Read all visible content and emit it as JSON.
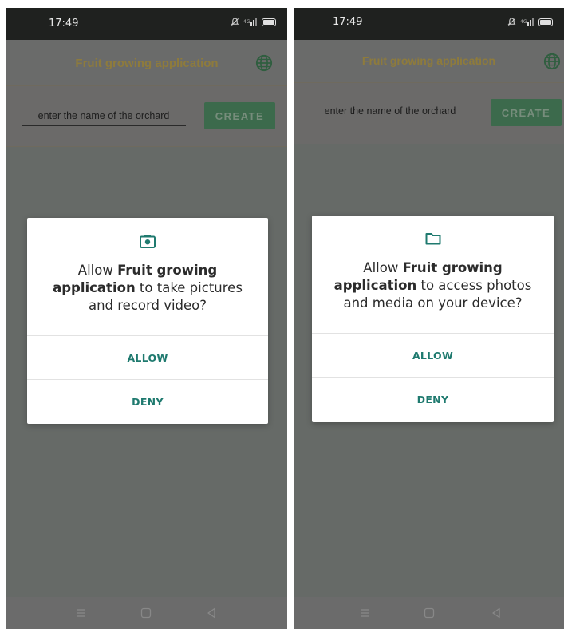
{
  "screens": [
    {
      "status": {
        "time": "17:49"
      },
      "app_bar": {
        "title": "Fruit growing application",
        "language_icon": "globe-icon"
      },
      "form": {
        "name_placeholder": "enter the name of the orchard",
        "create_label": "CREATE"
      },
      "dialog": {
        "icon": "camera-icon",
        "message_prefix": "Allow ",
        "app_name": "Fruit growing application",
        "message_suffix": " to take pictures and record video?",
        "allow_label": "ALLOW",
        "deny_label": "DENY"
      }
    },
    {
      "status": {
        "time": "17:49"
      },
      "app_bar": {
        "title": "Fruit growing application",
        "language_icon": "globe-icon"
      },
      "form": {
        "name_placeholder": "enter the name of the orchard",
        "create_label": "CREATE"
      },
      "dialog": {
        "icon": "folder-icon",
        "message_prefix": "Allow ",
        "app_name": "Fruit growing application",
        "message_suffix": " to access photos and media on your device?",
        "allow_label": "ALLOW",
        "deny_label": "DENY"
      }
    }
  ],
  "status_icons": [
    "mute-icon",
    "signal-icon",
    "battery-icon"
  ],
  "nav_icons": [
    "menu-icon",
    "home-icon",
    "back-icon"
  ],
  "colors": {
    "accent_teal": "#1f7a6f",
    "create_button": "#3c6a4c",
    "title_gold": "#8e7b3c",
    "scrim": "#666a67",
    "status_bar": "#1f211f"
  }
}
